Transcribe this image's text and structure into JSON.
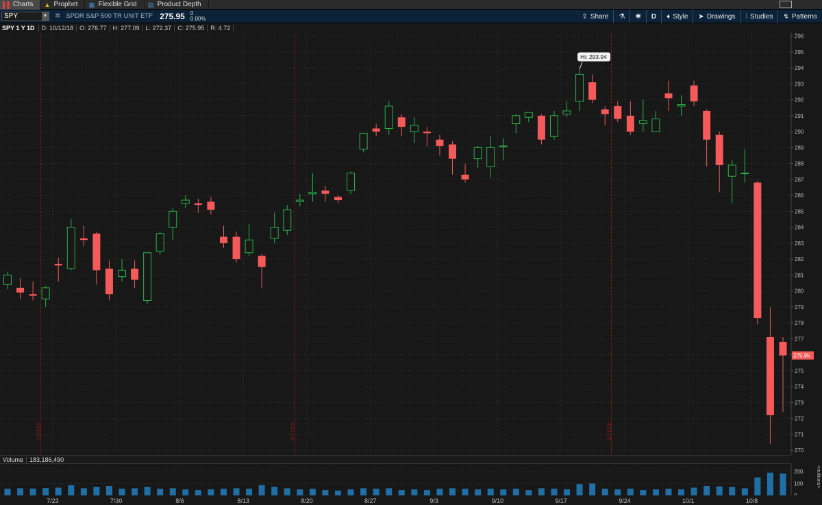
{
  "tabs": [
    {
      "label": "Charts",
      "icon": "bar-chart-icon",
      "active": true
    },
    {
      "label": "Prophet",
      "icon": "warning-icon",
      "active": false
    },
    {
      "label": "Flexible Grid",
      "icon": "grid-icon",
      "active": false
    },
    {
      "label": "Product Depth",
      "icon": "depth-icon",
      "active": false
    }
  ],
  "symbol": {
    "ticker": "SPY",
    "description": "SPDR S&P 500 TR UNIT ETF",
    "last": "275.95",
    "change": "0",
    "change_pct": "0.00%"
  },
  "toolbar": {
    "share": "Share",
    "aggregation": "D",
    "style": "Style",
    "drawings": "Drawings",
    "studies": "Studies",
    "patterns": "Patterns"
  },
  "info": {
    "label": "SPY 1 Y 1D",
    "date": "D: 10/12/18",
    "open": "O: 276.77",
    "high": "H: 277.09",
    "low": "L: 272.37",
    "close": "C: 275.95",
    "range": "R: 4.72"
  },
  "volume": {
    "label": "Volume",
    "value": "183,186,490",
    "unit": "<millions>",
    "ticks": [
      "200",
      "100",
      "0"
    ]
  },
  "colors": {
    "up": "#29b34a",
    "down": "#f55a5a",
    "volume": "#1f6fa6",
    "grid": "#3a3a3a",
    "marker": "#8a1c1c",
    "price_tag": "#f55a5a"
  },
  "chart_data": {
    "type": "candlestick",
    "y_ticks": [
      "270",
      "271",
      "272",
      "273",
      "274",
      "275",
      "276",
      "277",
      "278",
      "279",
      "280",
      "281",
      "282",
      "283",
      "284",
      "285",
      "286",
      "287",
      "288",
      "289",
      "290",
      "291",
      "292",
      "293",
      "294",
      "295",
      "296"
    ],
    "ylim": [
      269.7,
      296.2
    ],
    "x_ticks": [
      "7/23",
      "7/30",
      "8/6",
      "8/13",
      "8/20",
      "8/27",
      "9/3",
      "9/10",
      "9/17",
      "9/24",
      "10/1",
      "10/8"
    ],
    "event_markers": [
      "7/20/18",
      "8/17/18",
      "9/21/18"
    ],
    "high_label": "Hi: 293.94",
    "last_price_label": "275.95",
    "candles": [
      {
        "o": 280.4,
        "h": 281.2,
        "l": 280.1,
        "c": 281.0,
        "v": 55
      },
      {
        "o": 280.2,
        "h": 280.8,
        "l": 279.5,
        "c": 279.9,
        "v": 60
      },
      {
        "o": 279.8,
        "h": 280.6,
        "l": 279.4,
        "c": 279.7,
        "v": 58
      },
      {
        "o": 279.5,
        "h": 280.3,
        "l": 279.0,
        "c": 280.2,
        "v": 62
      },
      {
        "o": 281.7,
        "h": 282.1,
        "l": 280.6,
        "c": 281.6,
        "v": 65
      },
      {
        "o": 281.4,
        "h": 284.5,
        "l": 281.3,
        "c": 284.0,
        "v": 85
      },
      {
        "o": 283.3,
        "h": 284.1,
        "l": 282.8,
        "c": 283.2,
        "v": 60
      },
      {
        "o": 283.6,
        "h": 283.7,
        "l": 280.4,
        "c": 281.3,
        "v": 70
      },
      {
        "o": 281.4,
        "h": 281.9,
        "l": 279.4,
        "c": 279.8,
        "v": 80
      },
      {
        "o": 280.9,
        "h": 282.0,
        "l": 280.6,
        "c": 281.3,
        "v": 55
      },
      {
        "o": 281.4,
        "h": 281.9,
        "l": 280.2,
        "c": 280.7,
        "v": 60
      },
      {
        "o": 279.4,
        "h": 282.4,
        "l": 279.2,
        "c": 282.4,
        "v": 70
      },
      {
        "o": 282.5,
        "h": 283.7,
        "l": 282.3,
        "c": 283.6,
        "v": 55
      },
      {
        "o": 284.0,
        "h": 285.2,
        "l": 283.2,
        "c": 285.0,
        "v": 60
      },
      {
        "o": 285.5,
        "h": 286.0,
        "l": 285.2,
        "c": 285.7,
        "v": 50
      },
      {
        "o": 285.5,
        "h": 285.8,
        "l": 284.9,
        "c": 285.4,
        "v": 45
      },
      {
        "o": 285.6,
        "h": 285.9,
        "l": 284.8,
        "c": 285.1,
        "v": 50
      },
      {
        "o": 283.4,
        "h": 284.1,
        "l": 282.7,
        "c": 283.0,
        "v": 55
      },
      {
        "o": 283.4,
        "h": 283.7,
        "l": 281.8,
        "c": 282.0,
        "v": 60
      },
      {
        "o": 282.4,
        "h": 284.2,
        "l": 282.2,
        "c": 283.2,
        "v": 55
      },
      {
        "o": 282.2,
        "h": 282.3,
        "l": 280.2,
        "c": 281.5,
        "v": 85
      },
      {
        "o": 283.3,
        "h": 284.9,
        "l": 283.0,
        "c": 284.0,
        "v": 70
      },
      {
        "o": 283.8,
        "h": 285.4,
        "l": 283.5,
        "c": 285.1,
        "v": 60
      },
      {
        "o": 285.6,
        "h": 286.1,
        "l": 285.3,
        "c": 285.7,
        "v": 50
      },
      {
        "o": 286.1,
        "h": 287.4,
        "l": 285.6,
        "c": 286.2,
        "v": 55
      },
      {
        "o": 286.3,
        "h": 286.6,
        "l": 285.6,
        "c": 286.1,
        "v": 45
      },
      {
        "o": 285.9,
        "h": 286.0,
        "l": 285.5,
        "c": 285.7,
        "v": 40
      },
      {
        "o": 286.3,
        "h": 287.5,
        "l": 286.1,
        "c": 287.4,
        "v": 50
      },
      {
        "o": 288.9,
        "h": 289.8,
        "l": 288.7,
        "c": 289.9,
        "v": 60
      },
      {
        "o": 290.2,
        "h": 290.5,
        "l": 289.7,
        "c": 290.0,
        "v": 55
      },
      {
        "o": 290.2,
        "h": 291.9,
        "l": 289.8,
        "c": 291.6,
        "v": 60
      },
      {
        "o": 290.9,
        "h": 291.1,
        "l": 289.7,
        "c": 290.3,
        "v": 45
      },
      {
        "o": 290.0,
        "h": 290.9,
        "l": 289.3,
        "c": 290.4,
        "v": 50
      },
      {
        "o": 290.0,
        "h": 290.3,
        "l": 289.1,
        "c": 289.9,
        "v": 45
      },
      {
        "o": 289.5,
        "h": 289.8,
        "l": 288.5,
        "c": 289.1,
        "v": 55
      },
      {
        "o": 289.2,
        "h": 289.4,
        "l": 287.3,
        "c": 288.3,
        "v": 60
      },
      {
        "o": 287.3,
        "h": 288.0,
        "l": 286.8,
        "c": 287.0,
        "v": 55
      },
      {
        "o": 288.3,
        "h": 289.1,
        "l": 287.7,
        "c": 289.0,
        "v": 50
      },
      {
        "o": 287.8,
        "h": 289.7,
        "l": 287.1,
        "c": 289.0,
        "v": 55
      },
      {
        "o": 289.1,
        "h": 289.6,
        "l": 288.2,
        "c": 289.1,
        "v": 50
      },
      {
        "o": 290.5,
        "h": 291.1,
        "l": 289.9,
        "c": 291.0,
        "v": 55
      },
      {
        "o": 290.9,
        "h": 291.2,
        "l": 290.6,
        "c": 291.2,
        "v": 45
      },
      {
        "o": 291.0,
        "h": 291.1,
        "l": 289.2,
        "c": 289.5,
        "v": 60
      },
      {
        "o": 289.7,
        "h": 291.3,
        "l": 289.5,
        "c": 291.0,
        "v": 55
      },
      {
        "o": 291.1,
        "h": 291.9,
        "l": 290.9,
        "c": 291.3,
        "v": 50
      },
      {
        "o": 291.9,
        "h": 293.94,
        "l": 291.3,
        "c": 293.6,
        "v": 95
      },
      {
        "o": 293.1,
        "h": 293.6,
        "l": 291.8,
        "c": 292.0,
        "v": 100
      },
      {
        "o": 291.4,
        "h": 291.6,
        "l": 290.4,
        "c": 291.1,
        "v": 55
      },
      {
        "o": 291.6,
        "h": 291.9,
        "l": 290.6,
        "c": 290.8,
        "v": 50
      },
      {
        "o": 291.0,
        "h": 291.9,
        "l": 289.8,
        "c": 290.0,
        "v": 55
      },
      {
        "o": 290.5,
        "h": 292.0,
        "l": 290.0,
        "c": 290.7,
        "v": 45
      },
      {
        "o": 290.0,
        "h": 291.3,
        "l": 290.0,
        "c": 290.8,
        "v": 50
      },
      {
        "o": 292.4,
        "h": 293.2,
        "l": 291.3,
        "c": 292.1,
        "v": 55
      },
      {
        "o": 291.6,
        "h": 292.3,
        "l": 291.0,
        "c": 291.7,
        "v": 50
      },
      {
        "o": 292.9,
        "h": 293.2,
        "l": 291.6,
        "c": 291.9,
        "v": 65
      },
      {
        "o": 291.3,
        "h": 291.4,
        "l": 287.8,
        "c": 289.5,
        "v": 80
      },
      {
        "o": 289.8,
        "h": 290.0,
        "l": 286.2,
        "c": 287.9,
        "v": 75
      },
      {
        "o": 287.2,
        "h": 288.2,
        "l": 285.5,
        "c": 287.9,
        "v": 70
      },
      {
        "o": 287.4,
        "h": 288.9,
        "l": 286.8,
        "c": 287.4,
        "v": 60
      },
      {
        "o": 286.8,
        "h": 286.9,
        "l": 277.9,
        "c": 278.3,
        "v": 150
      },
      {
        "o": 277.1,
        "h": 279.0,
        "l": 270.4,
        "c": 272.2,
        "v": 190
      },
      {
        "o": 276.8,
        "h": 277.1,
        "l": 272.4,
        "c": 275.95,
        "v": 183
      }
    ]
  }
}
